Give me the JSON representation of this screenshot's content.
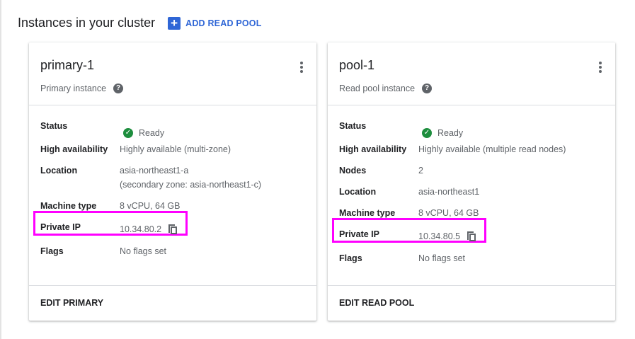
{
  "header": {
    "title": "Instances in your cluster",
    "add_read_pool": "ADD READ POOL"
  },
  "cards": [
    {
      "name": "primary-1",
      "type": "Primary instance",
      "rows": {
        "status": {
          "label": "Status",
          "value": "Ready"
        },
        "ha": {
          "label": "High availability",
          "value": "Highly available (multi-zone)"
        },
        "location": {
          "label": "Location",
          "value": "asia-northeast1-a",
          "value2": "(secondary zone: asia-northeast1-c)"
        },
        "machine": {
          "label": "Machine type",
          "value": "8 vCPU, 64 GB"
        },
        "ip": {
          "label": "Private IP",
          "value": "10.34.80.2"
        },
        "flags": {
          "label": "Flags",
          "value": "No flags set"
        }
      },
      "action": "EDIT PRIMARY"
    },
    {
      "name": "pool-1",
      "type": "Read pool instance",
      "rows": {
        "status": {
          "label": "Status",
          "value": "Ready"
        },
        "ha": {
          "label": "High availability",
          "value": "Highly available (multiple read nodes)"
        },
        "nodes": {
          "label": "Nodes",
          "value": "2"
        },
        "location": {
          "label": "Location",
          "value": "asia-northeast1"
        },
        "machine": {
          "label": "Machine type",
          "value": "8 vCPU, 64 GB"
        },
        "ip": {
          "label": "Private IP",
          "value": "10.34.80.5"
        },
        "flags": {
          "label": "Flags",
          "value": "No flags set"
        }
      },
      "action": "EDIT READ POOL"
    }
  ],
  "colors": {
    "accent": "#2f66d6",
    "ready": "#1e8e3e",
    "highlight": "#ff00ff"
  }
}
